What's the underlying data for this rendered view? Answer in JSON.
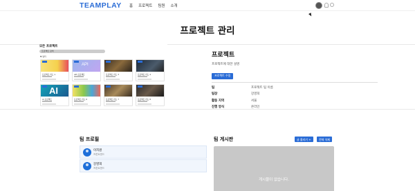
{
  "nav": {
    "logo": "TEAMPLAY",
    "links": [
      "홈",
      "프로젝트",
      "팀원",
      "소개"
    ]
  },
  "page": {
    "title": "프로젝트 관리"
  },
  "preview": {
    "title": "모든 프로젝트",
    "search_placeholder": "프로젝트 검색",
    "filter": "▼ 필터",
    "cards": [
      {
        "title": "프로젝트 카드 1"
      },
      {
        "title": "API 프로젝트"
      },
      {
        "title": "프로젝트 카드 3"
      },
      {
        "title": "프로젝트 카드 4"
      },
      {
        "title": "AI 프로젝트"
      },
      {
        "title": "프로젝트 카드 6"
      },
      {
        "title": "프로젝트 카드 7"
      },
      {
        "title": "프로젝트 카드 8"
      }
    ]
  },
  "project": {
    "title": "프로젝트",
    "description": "프로젝트에 대한 설명",
    "edit_button": "프로젝트 수정",
    "fields": [
      {
        "key": "팀",
        "value": "프로젝트 팀 이름"
      },
      {
        "key": "팀장",
        "value": "강영희"
      },
      {
        "key": "활동 지역",
        "value": "서울"
      },
      {
        "key": "진행 방식",
        "value": "온라인"
      }
    ]
  },
  "team_profile": {
    "title": "팀 프로필",
    "members": [
      {
        "name": "이지원",
        "role": "프론트엔드"
      },
      {
        "name": "강영희",
        "role": "프론트엔드"
      }
    ]
  },
  "board": {
    "title": "팀 게시판",
    "write_button": "글 올리기 +",
    "delete_button": "전체 삭제",
    "empty_text": "게시물이 없습니다."
  },
  "colors": {
    "accent": "#2a6cd6",
    "board_bg": "#c8c8c8"
  }
}
